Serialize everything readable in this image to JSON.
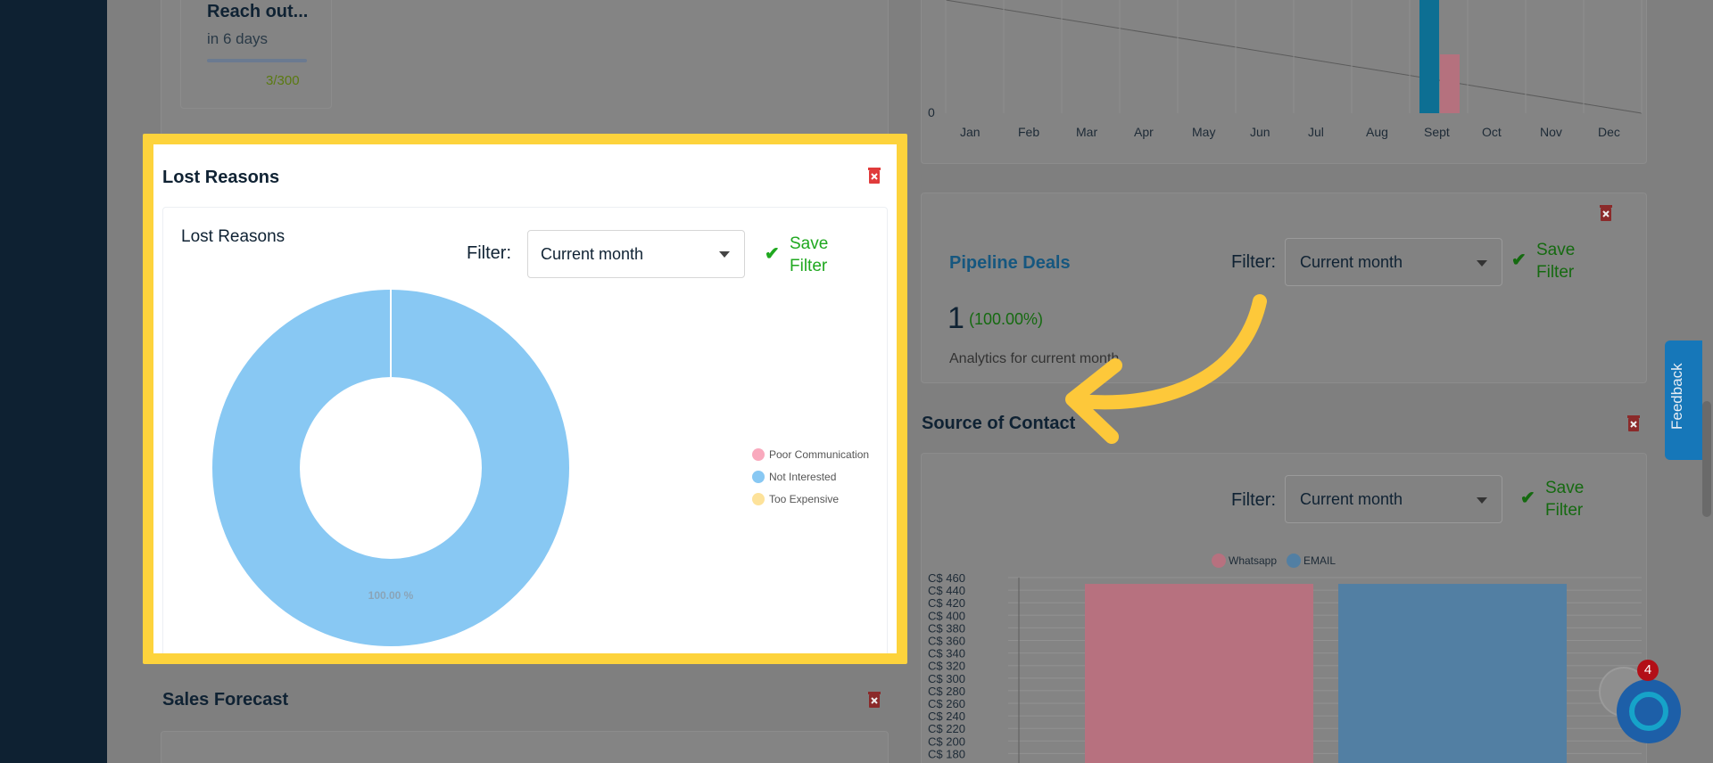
{
  "goal": {
    "title": "Reach out...",
    "subtitle": "in 6 days",
    "count": "3/300"
  },
  "top_chart": {
    "y_zero": "0",
    "months": [
      "Jan",
      "Feb",
      "Mar",
      "Apr",
      "May",
      "Jun",
      "Jul",
      "Aug",
      "Sept",
      "Oct",
      "Nov",
      "Dec"
    ]
  },
  "pipeline": {
    "title": "Pipeline Deals",
    "filter_label": "Filter:",
    "filter_value": "Current month",
    "save_label": "Save Filter",
    "count": "1",
    "percent": "(100.00%)",
    "analytics": "Analytics for current month"
  },
  "lost_reasons": {
    "title": "Lost Reasons",
    "inner_title": "Lost Reasons",
    "filter_label": "Filter:",
    "filter_value": "Current month",
    "save_label": "Save Filter"
  },
  "chart_data": [
    {
      "type": "pie",
      "categories": [
        "Poor Communication",
        "Not Interested",
        "Too Expensive"
      ],
      "values": [
        0,
        100,
        0
      ],
      "colors": [
        "#f9a9bd",
        "#88c8f3",
        "#fde29a"
      ],
      "slice_label": "100.00 %",
      "legend": "right"
    },
    {
      "type": "bar",
      "categories": [
        "Whatsapp",
        "EMAIL"
      ],
      "series": [
        {
          "name": "Whatsapp",
          "values": [
            450
          ],
          "color": "#b7717f"
        },
        {
          "name": "EMAIL",
          "values": [
            450
          ],
          "color": "#527fa3"
        }
      ],
      "y_ticks": [
        "C$ 460",
        "C$ 440",
        "C$ 420",
        "C$ 400",
        "C$ 380",
        "C$ 360",
        "C$ 340",
        "C$ 320",
        "C$ 300",
        "C$ 280",
        "C$ 260",
        "C$ 240",
        "C$ 220",
        "C$ 200",
        "C$ 180"
      ],
      "ylim": [
        180,
        460
      ],
      "legend": "top"
    }
  ],
  "source_of_contact": {
    "title": "Source of Contact",
    "filter_label": "Filter:",
    "filter_value": "Current month",
    "save_label": "Save Filter"
  },
  "sales_forecast": {
    "title": "Sales Forecast"
  },
  "feedback": {
    "label": "Feedback"
  },
  "chat": {
    "badge": "4"
  },
  "colors": {
    "highlight": "#fdd33c",
    "sidebar": "#0e2132",
    "save_green": "#1fa81f",
    "delete_red": "#e03b3b"
  }
}
